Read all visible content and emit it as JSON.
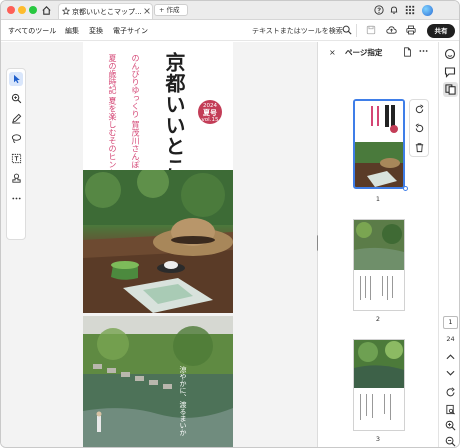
{
  "titlebar": {
    "tab_title": "京都いいとこマップ...",
    "new_tab_label": "作成"
  },
  "menubar": {
    "items": [
      "すべてのツール",
      "編集",
      "変換",
      "電子サイン"
    ],
    "search_placeholder": "テキストまたはツールを検索",
    "share_label": "共有"
  },
  "document": {
    "cover_title": "京都いいとこマップ",
    "cover_subtitle_1": "のんびりゆっくり 賀茂川さんぽ",
    "cover_subtitle_2": "夏の歳時記 夏を楽しむそのヒント",
    "badge_line1": "2024",
    "badge_line2": "夏号",
    "badge_line3": "vol.15",
    "page2_caption": "涼やかに、渡るまいか"
  },
  "panel": {
    "title": "ページ指定",
    "thumbnails": [
      {
        "label": "1",
        "selected": true
      },
      {
        "label": "2",
        "selected": false
      },
      {
        "label": "3",
        "selected": false
      }
    ]
  },
  "navigation": {
    "current_page": "1",
    "total_pages": "24"
  },
  "colors": {
    "accent": "#3f7ee8",
    "cover_pink": "#d44574",
    "badge_red": "#c33d57",
    "share_bg": "#1f1f1f"
  }
}
